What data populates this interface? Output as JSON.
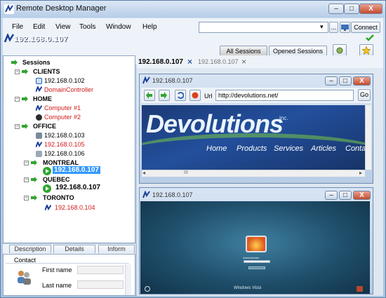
{
  "app": {
    "title": "Remote Desktop Manager",
    "host": "192.168.0.107"
  },
  "window_buttons": {
    "minimize": "–",
    "maximize": "□",
    "close": "X"
  },
  "menu": [
    "File",
    "Edit",
    "View",
    "Tools",
    "Window",
    "Help"
  ],
  "toolbar": {
    "search_value": "",
    "connect_label": "Connect",
    "ellipsis": "...",
    "dropdown": "▾"
  },
  "session_buttons": {
    "all": "All Sessions",
    "open": "Opened Sessions"
  },
  "tree": {
    "root": "Sessions",
    "clients": {
      "label": "CLIENTS",
      "items": [
        "192.168.0.102",
        "DomainController"
      ]
    },
    "home": {
      "label": "HOME",
      "items": [
        "Computer #1",
        "Computer #2"
      ]
    },
    "office": {
      "label": "OFFICE",
      "items": [
        "192.168.0.103",
        "192.168.0.105",
        "192.168.0.106"
      ]
    },
    "montreal": {
      "label": "MONTREAL",
      "item": "192.168.0.107"
    },
    "quebec": {
      "label": "QUEBEC",
      "item": "192.168.0.107"
    },
    "toronto": {
      "label": "TORONTO",
      "item": "192.168.0.104"
    }
  },
  "bottom_tabs": [
    "Description",
    "Details",
    "Inform"
  ],
  "contact": {
    "header": "Contact",
    "first_name": "First name",
    "last_name": "Last name"
  },
  "doc_tabs": {
    "active": "192.168.0.107",
    "inactive": "192.168.0.107",
    "close": "×"
  },
  "browser_window": {
    "title": "192.168.0.107",
    "url_label": "Url",
    "url": "http://devolutions.net/",
    "go": "Go",
    "scroll_mark": "III"
  },
  "website": {
    "logo": "Devolutions",
    "logo_suffix": "inc.",
    "nav": [
      "Home",
      "Products",
      "Services",
      "Articles",
      "Conta"
    ]
  },
  "vista_window": {
    "title": "192.168.0.107",
    "user": "Administrator",
    "brand": "Windows Vista"
  },
  "colors": {
    "selection": "#3399ff",
    "red_item": "#d11a1a",
    "green_arrow": "#2fa52f",
    "banner_blue": "#1f4690"
  }
}
